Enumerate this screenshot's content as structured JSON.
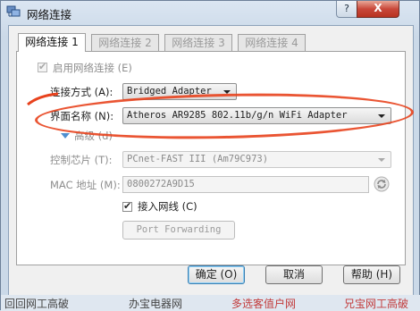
{
  "window": {
    "title": "网络连接",
    "help_label": "?",
    "close_label": "X"
  },
  "tabs": [
    {
      "label": "网络连接 1",
      "active": true
    },
    {
      "label": "网络连接 2",
      "active": false
    },
    {
      "label": "网络连接 3",
      "active": false
    },
    {
      "label": "网络连接 4",
      "active": false
    }
  ],
  "form": {
    "enable_adapter_label": "启用网络连接 (E)",
    "attached_to_label": "连接方式 (A):",
    "attached_to_value": "Bridged Adapter",
    "name_label": "界面名称 (N):",
    "name_value": "Atheros AR9285 802.11b/g/n WiFi Adapter",
    "advanced_label": "高级 (d)",
    "adapter_type_label": "控制芯片 (T):",
    "adapter_type_value": "PCnet-FAST III (Am79C973)",
    "mac_label": "MAC 地址 (M):",
    "mac_value": "0800272A9D15",
    "cable_label": "接入网线 (C)",
    "port_forwarding_label": "Port Forwarding"
  },
  "buttons": {
    "ok": "确定 (O)",
    "cancel": "取消",
    "help": "帮助 (H)"
  },
  "background_text": [
    "回回网工高破",
    "办宝电器网",
    "多选客值户网",
    "兄宝网工高破"
  ]
}
